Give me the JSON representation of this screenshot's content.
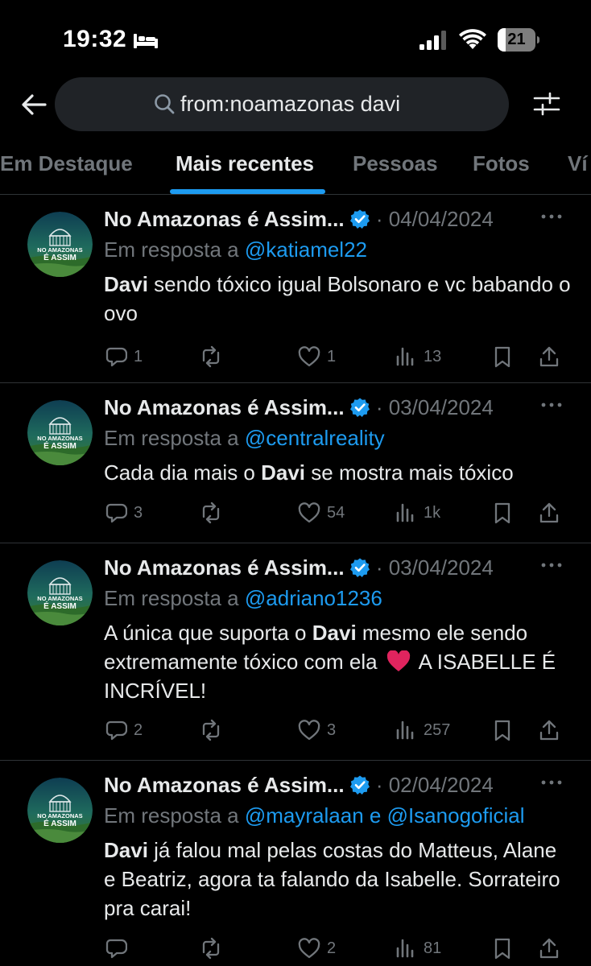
{
  "status_bar": {
    "time": "19:32",
    "battery_level": "21",
    "icons": [
      "bed-icon",
      "signal-icon",
      "wifi-icon",
      "battery-icon"
    ]
  },
  "search": {
    "query": "from:noamazonas davi"
  },
  "tabs": [
    {
      "label": "Em Destaque"
    },
    {
      "label": "Mais recentes"
    },
    {
      "label": "Pessoas"
    },
    {
      "label": "Fotos"
    },
    {
      "label": "Ví"
    }
  ],
  "colors": {
    "background": "#000000",
    "accent": "#1d9bf0",
    "muted": "#71767b",
    "heart_red": "#e0245e"
  },
  "tweets": [
    {
      "name": "No Amazonas é Assim...",
      "date": "· 04/04/2024",
      "reply_label": "Em resposta a",
      "reply_handles": "@katiamel22",
      "body": [
        {
          "text": "Davi",
          "bold": true
        },
        {
          "text": " sendo tóxico igual Bolsonaro e vc babando o ovo",
          "bold": false
        }
      ],
      "replies": "1",
      "retweets": "",
      "likes": "1",
      "views": "13"
    },
    {
      "name": "No Amazonas é Assim...",
      "date": "· 03/04/2024",
      "reply_label": "Em resposta a",
      "reply_handles": "@centralreality",
      "body": [
        {
          "text": "Cada dia mais o ",
          "bold": false
        },
        {
          "text": "Davi",
          "bold": true
        },
        {
          "text": " se mostra mais tóxico",
          "bold": false
        }
      ],
      "replies": "3",
      "retweets": "",
      "likes": "54",
      "views": "1k"
    },
    {
      "name": "No Amazonas é Assim...",
      "date": "· 03/04/2024",
      "reply_label": "Em resposta a",
      "reply_handles": "@adriano1236",
      "body": [
        {
          "text": "A única que suporta o ",
          "bold": false
        },
        {
          "text": "Davi",
          "bold": true
        },
        {
          "text": " mesmo ele sendo extremamente tóxico com ela ",
          "bold": false
        },
        {
          "emoji": "red-heart-emoji"
        },
        {
          "text": " A ISABELLE É INCRÍVEL!",
          "bold": false
        }
      ],
      "replies": "2",
      "retweets": "",
      "likes": "3",
      "views": "257"
    },
    {
      "name": "No Amazonas é Assim...",
      "date": "· 02/04/2024",
      "reply_label": "Em resposta a",
      "reply_handles": "@mayralaan e @Isanogoficial",
      "body": [
        {
          "text": "Davi",
          "bold": true
        },
        {
          "text": " já falou mal pelas costas do Matteus, Alane e Beatriz, agora ta falando da Isabelle. Sorrateiro pra carai!",
          "bold": false
        }
      ],
      "replies": "",
      "retweets": "",
      "likes": "2",
      "views": "81"
    }
  ],
  "avatar": {
    "line1": "NO AMAZONAS",
    "line2": "É ASSIM"
  }
}
